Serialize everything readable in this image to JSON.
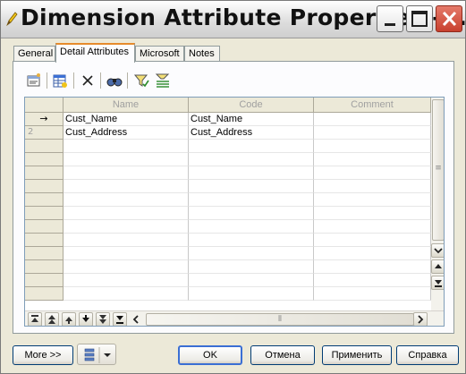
{
  "window": {
    "title": "Dimension Attribute Properties - ...",
    "buttons": [
      "minimize",
      "maximize",
      "close"
    ]
  },
  "tabs": [
    {
      "label": "General",
      "active": false
    },
    {
      "label": "Detail Attributes",
      "active": true
    },
    {
      "label": "Microsoft",
      "active": false
    },
    {
      "label": "Notes",
      "active": false
    }
  ],
  "toolbar": {
    "tools": [
      "properties-icon",
      "add-rows-icon",
      "delete-icon",
      "find-icon",
      "filter-icon",
      "customize-columns-icon"
    ]
  },
  "grid": {
    "columns": [
      "Name",
      "Code",
      "Comment"
    ],
    "rows": [
      {
        "row_marker": "→",
        "name": "Cust_Name",
        "code": "Cust_Name",
        "comment": ""
      },
      {
        "row_marker": "2",
        "name": "Cust_Address",
        "code": "Cust_Address",
        "comment": ""
      }
    ],
    "empty_row_count": 14,
    "vertical_scroll_grip": "≡",
    "horizontal_scroll_grip": "⦀"
  },
  "row_nav_buttons": [
    "move-top-icon",
    "move-page-up-icon",
    "move-up-icon",
    "move-down-icon",
    "move-page-down-icon",
    "move-bottom-icon"
  ],
  "footer": {
    "more_label": "More >>",
    "ok_label": "OK",
    "cancel_label": "Отмена",
    "apply_label": "Применить",
    "help_label": "Справка"
  },
  "colors": {
    "title_gradient_top": "#ffffff",
    "window_bg": "#ece9d8",
    "close_button": "#c8402e",
    "tab_highlight": "#e68b2c",
    "default_button_border": "#3b6fd4"
  }
}
